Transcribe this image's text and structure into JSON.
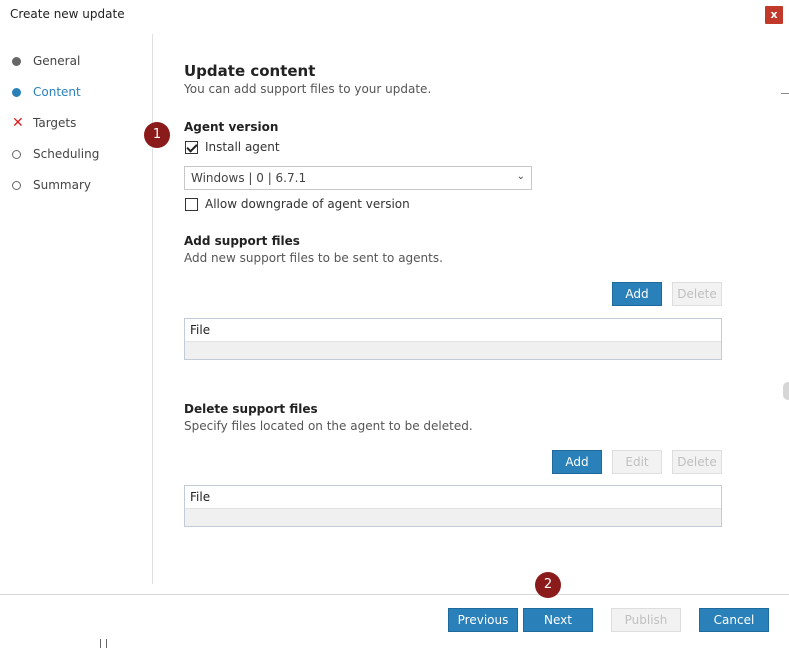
{
  "window": {
    "title": "Create new update",
    "close_label": "x"
  },
  "nav": {
    "items": [
      {
        "label": "General",
        "state": "complete"
      },
      {
        "label": "Content",
        "state": "active"
      },
      {
        "label": "Targets",
        "state": "error"
      },
      {
        "label": "Scheduling",
        "state": "pending"
      },
      {
        "label": "Summary",
        "state": "pending"
      }
    ]
  },
  "content": {
    "heading": "Update content",
    "subheading": "You can add support files to your update.",
    "callouts": [
      "1",
      "2"
    ],
    "agent_version": {
      "heading": "Agent version",
      "install_agent_label": "Install agent",
      "install_agent_checked": true,
      "version_selected": "Windows | 0 | 6.7.1",
      "allow_downgrade_label": "Allow downgrade of agent version",
      "allow_downgrade_checked": false
    },
    "add_support": {
      "heading": "Add support files",
      "description": "Add new support files to be sent to agents.",
      "add_label": "Add",
      "delete_label": "Delete",
      "table_header": "File"
    },
    "delete_support": {
      "heading": "Delete support files",
      "description": "Specify files located on the agent to be deleted.",
      "add_label": "Add",
      "edit_label": "Edit",
      "delete_label": "Delete",
      "table_header": "File"
    }
  },
  "footer": {
    "previous_label": "Previous",
    "next_label": "Next",
    "publish_label": "Publish",
    "cancel_label": "Cancel"
  },
  "colors": {
    "accent": "#2a80b9",
    "error": "#e02020",
    "callout": "#8b1a1a",
    "close": "#c0392b"
  }
}
